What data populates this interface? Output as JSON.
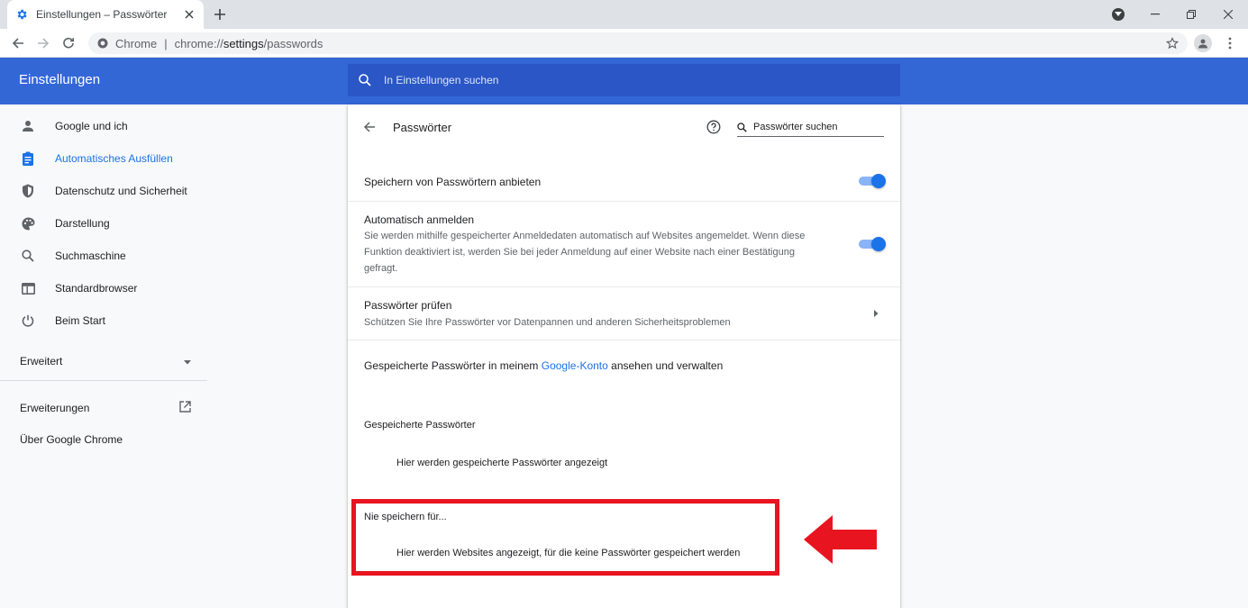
{
  "browser": {
    "tab_title": "Einstellungen – Passwörter",
    "url_scheme_label": "Chrome",
    "url_prefix": "chrome://",
    "url_host": "settings",
    "url_path": "/passwords"
  },
  "header": {
    "title": "Einstellungen",
    "search_placeholder": "In Einstellungen suchen"
  },
  "sidebar": {
    "items": [
      {
        "label": "Google und ich",
        "icon": "person-icon"
      },
      {
        "label": "Automatisches Ausfüllen",
        "icon": "clipboard-icon",
        "active": true
      },
      {
        "label": "Datenschutz und Sicherheit",
        "icon": "shield-icon"
      },
      {
        "label": "Darstellung",
        "icon": "palette-icon"
      },
      {
        "label": "Suchmaschine",
        "icon": "search-icon"
      },
      {
        "label": "Standardbrowser",
        "icon": "browser-icon"
      },
      {
        "label": "Beim Start",
        "icon": "power-icon"
      }
    ],
    "advanced_label": "Erweitert",
    "extensions_label": "Erweiterungen",
    "about_label": "Über Google Chrome"
  },
  "passwords": {
    "title": "Passwörter",
    "search_placeholder": "Passwörter suchen",
    "offer_save": {
      "label": "Speichern von Passwörtern anbieten",
      "enabled": true
    },
    "auto_signin": {
      "label": "Automatisch anmelden",
      "description_line1": "Sie werden mithilfe gespeicherter Anmeldedaten automatisch auf Websites angemeldet. Wenn diese",
      "description_line2": "Funktion deaktiviert ist, werden Sie bei jeder Anmeldung auf einer Website nach einer Bestätigung",
      "description_line3": "gefragt.",
      "enabled": true
    },
    "check": {
      "label": "Passwörter prüfen",
      "description": "Schützen Sie Ihre Passwörter vor Datenpannen und anderen Sicherheitsproblemen"
    },
    "account_text_before": "Gespeicherte Passwörter in meinem ",
    "account_link": "Google-Konto",
    "account_text_after": " ansehen und verwalten",
    "saved_heading": "Gespeicherte Passwörter",
    "saved_empty": "Hier werden gespeicherte Passwörter angezeigt",
    "never_heading": "Nie speichern für...",
    "never_empty": "Hier werden Websites angezeigt, für die keine Passwörter gespeichert werden"
  },
  "colors": {
    "header_blue": "#3367d6",
    "accent": "#1a73e8",
    "annotation_red": "#e8141f"
  }
}
